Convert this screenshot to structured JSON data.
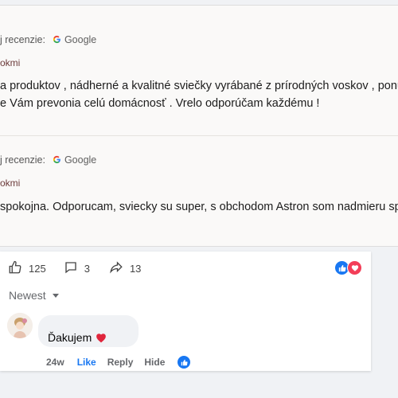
{
  "reviews": [
    {
      "source_prefix": "j recenzie:",
      "source_name": "Google",
      "author": "okmi",
      "line1": "a produktov , nádherné a kvalitné sviečky vyrábané z prírodných voskov , ponú",
      "line2": "e Vám prevonia celú domácnosť . Vrelo odporúčam každému !"
    },
    {
      "source_prefix": "j recenzie:",
      "source_name": "Google",
      "author": "okmi",
      "line1": "spokojna. Odporucam, sviecky su super, s obchodom Astron som nadmieru spo",
      "line2": ""
    }
  ],
  "post_actions": {
    "likes": "125",
    "comments": "3",
    "shares": "13"
  },
  "comments_sort": "Newest",
  "comment": {
    "text": "Ďakujem",
    "time": "24w",
    "like_label": "Like",
    "reply_label": "Reply",
    "hide_label": "Hide"
  },
  "colors": {
    "like_blue": "#1877f2",
    "heart_red": "#f33e58",
    "google_g": [
      "#4285f4",
      "#ea4335",
      "#fbbc05",
      "#34a853"
    ]
  }
}
